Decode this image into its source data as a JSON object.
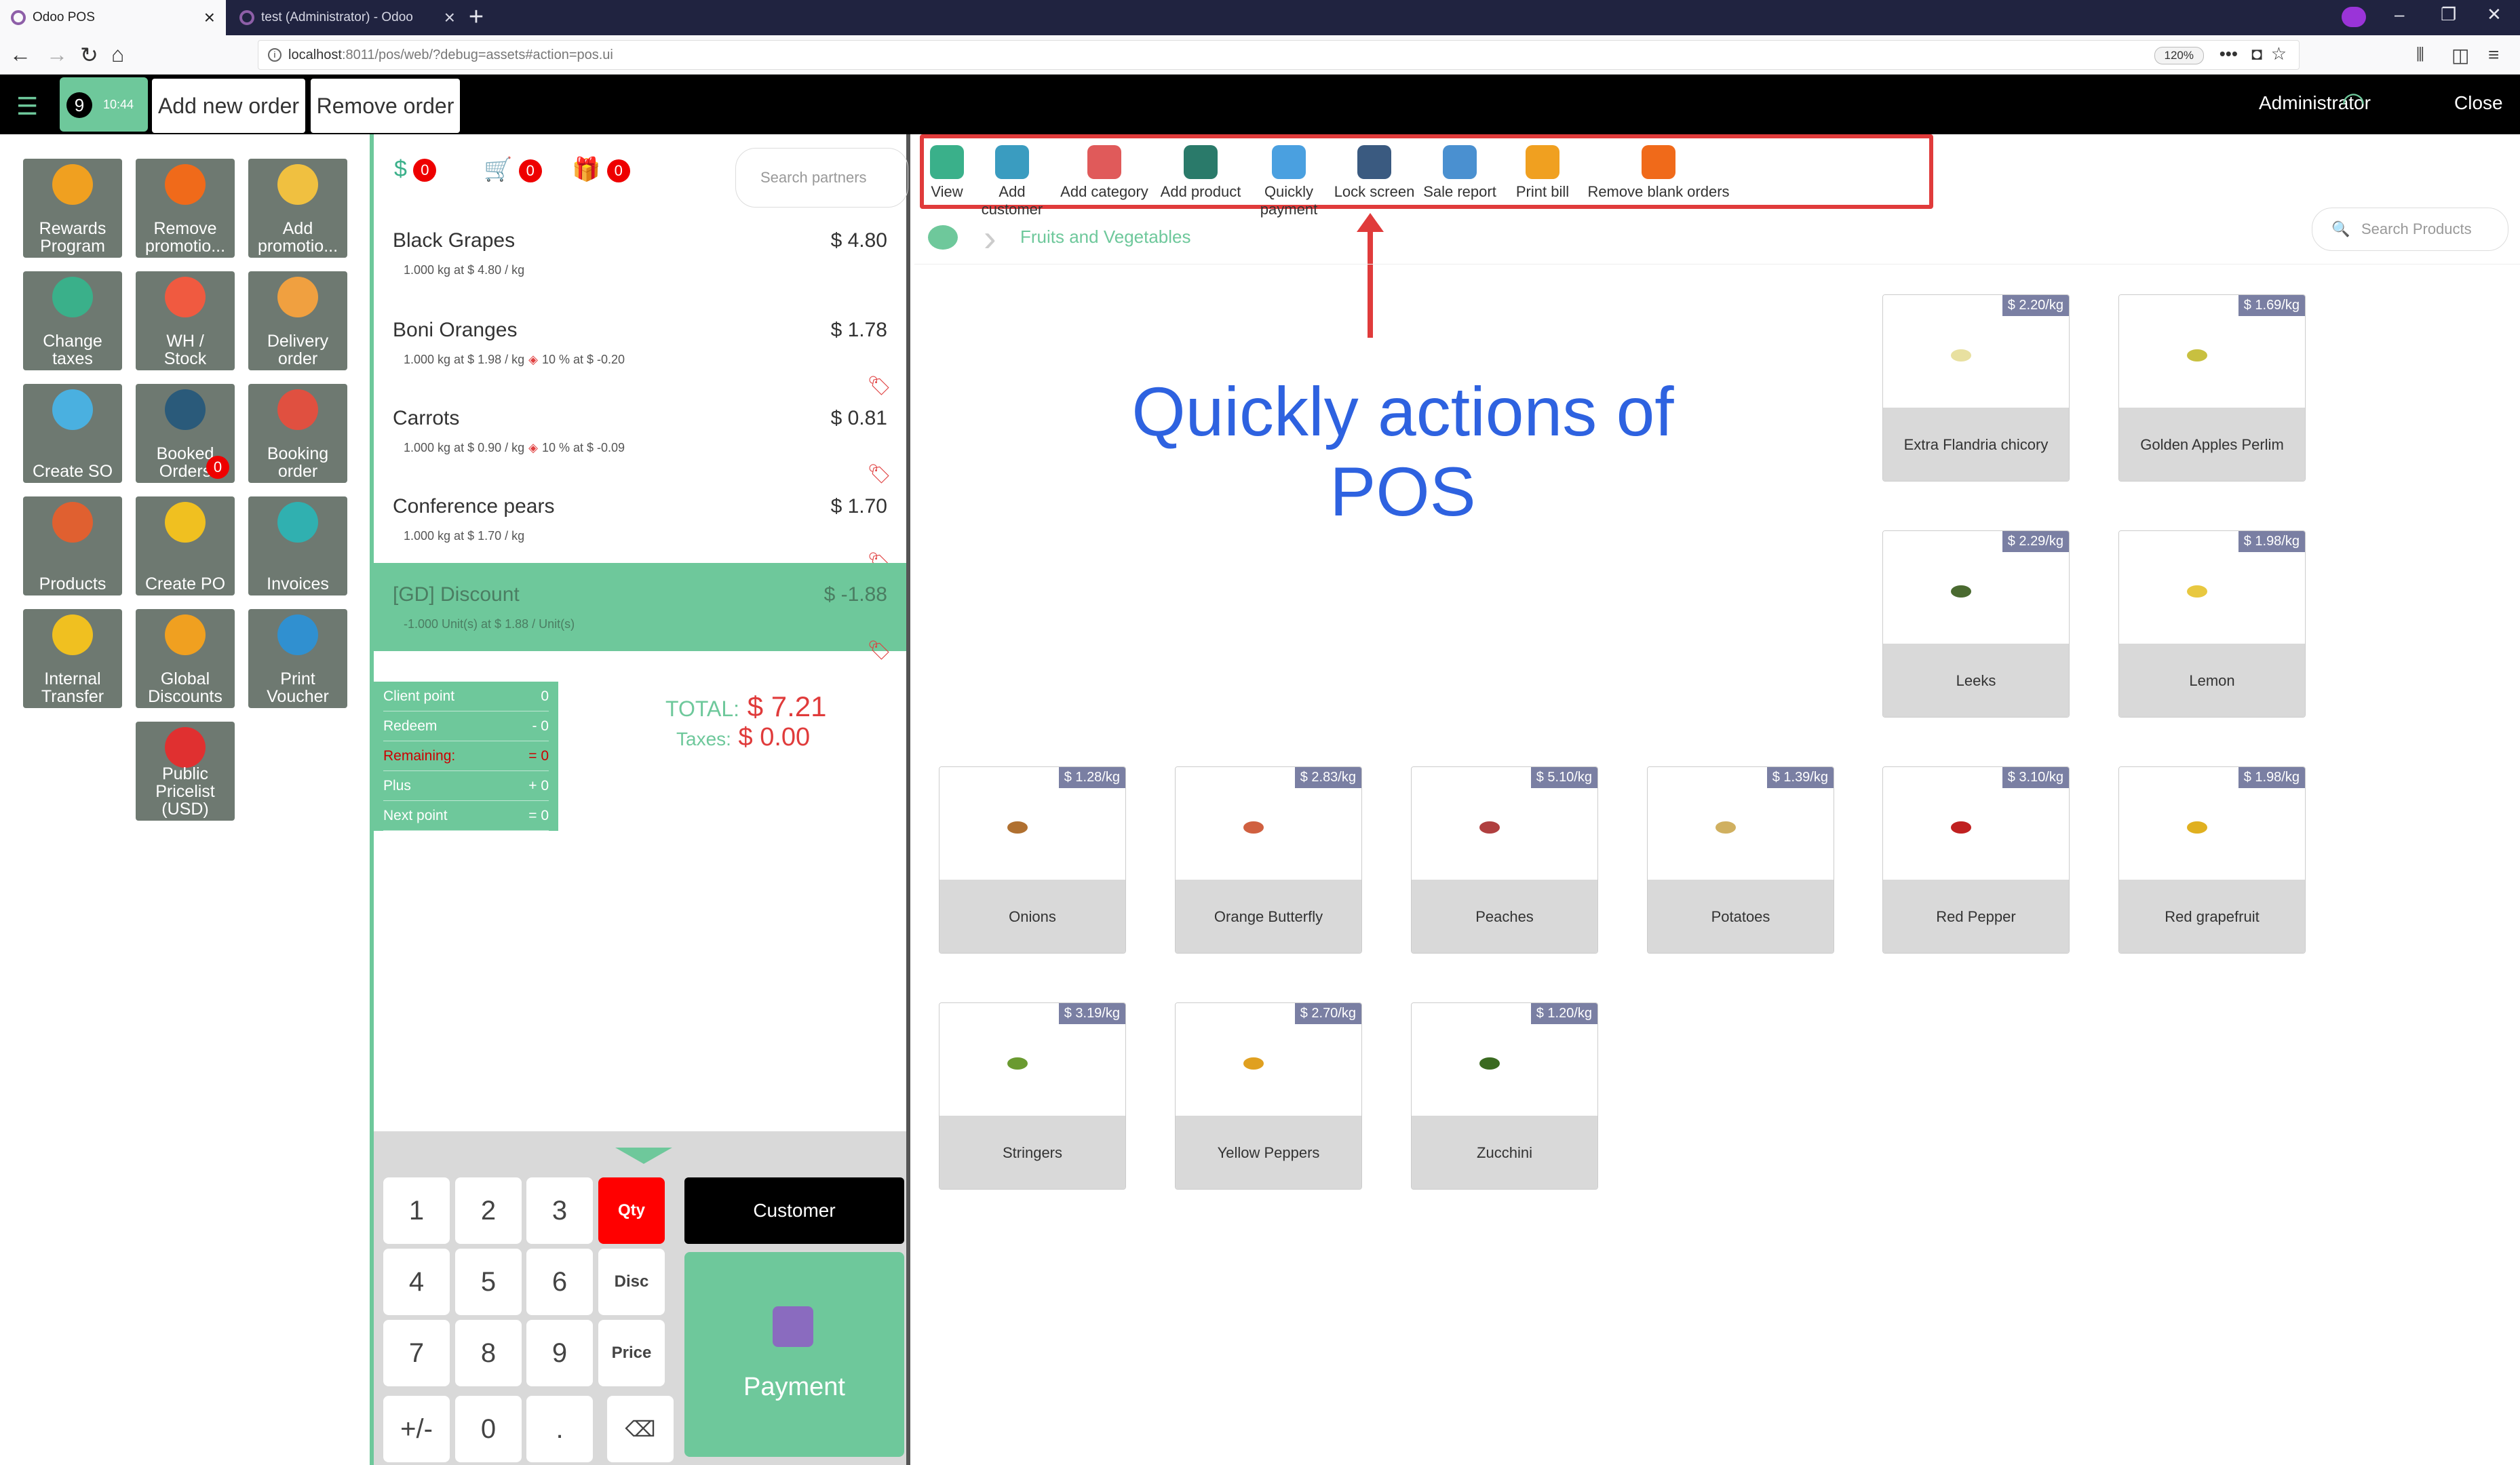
{
  "browser": {
    "tabs": [
      {
        "title": "Odoo POS"
      },
      {
        "title": "test (Administrator) - Odoo"
      }
    ],
    "url_host": "localhost",
    "url_rest": ":8011/pos/web/?debug=assets#action=pos.ui",
    "zoom": "120%",
    "dots": "•••"
  },
  "header": {
    "order_number": "9",
    "order_time": "10:44",
    "add_order_label": "Add new order",
    "remove_order_label": "Remove order",
    "user": "Administrator",
    "close_label": "Close"
  },
  "widgets": [
    {
      "label1": "Rewards",
      "label2": "Program",
      "icon": "rewards-icon",
      "color": "#f0a020"
    },
    {
      "label1": "Remove",
      "label2": "promotio...",
      "icon": "trash-icon",
      "color": "#f06a1a"
    },
    {
      "label1": "Add",
      "label2": "promotio...",
      "icon": "promotion-icon",
      "color": "#f0c040"
    },
    {
      "label1": "Change",
      "label2": "taxes",
      "icon": "taxes-icon",
      "color": "#3ab08a"
    },
    {
      "label1": "WH /",
      "label2": "Stock",
      "icon": "warehouse-icon",
      "color": "#f05a40"
    },
    {
      "label1": "Delivery",
      "label2": "order",
      "icon": "delivery-icon",
      "color": "#f0a040"
    },
    {
      "label1": "Create SO",
      "label2": "",
      "icon": "cart-icon",
      "color": "#4ab0e0"
    },
    {
      "label1": "Booked",
      "label2": "Orders",
      "icon": "booked-icon",
      "color": "#2a5a7a",
      "badge": "0"
    },
    {
      "label1": "Booking",
      "label2": "order",
      "icon": "headset-icon",
      "color": "#e05040"
    },
    {
      "label1": "Products",
      "label2": "",
      "icon": "barcode-icon",
      "color": "#e06030"
    },
    {
      "label1": "Create PO",
      "label2": "",
      "icon": "basket-icon",
      "color": "#f0c020"
    },
    {
      "label1": "Invoices",
      "label2": "",
      "icon": "invoice-icon",
      "color": "#30b0b0"
    },
    {
      "label1": "Internal",
      "label2": "Transfer",
      "icon": "truck-icon",
      "color": "#f0c020"
    },
    {
      "label1": "Global",
      "label2": "Discounts",
      "icon": "discount-tag-icon",
      "color": "#f0a020"
    },
    {
      "label1": "Print",
      "label2": "Voucher",
      "icon": "voucher-icon",
      "color": "#3090d0"
    },
    {
      "label1": "Public",
      "label2": "Pricelist",
      "label3": "(USD)",
      "icon": "pricelist-icon",
      "color": "#e03030"
    }
  ],
  "order": {
    "counters": [
      "0",
      "0",
      "0"
    ],
    "search_partners_placeholder": "Search partners",
    "lines": [
      {
        "name": "Black Grapes",
        "price": "$ 4.80",
        "info": "1.000 kg at $ 4.80 / kg",
        "discount": ""
      },
      {
        "name": "Boni Oranges",
        "price": "$ 1.78",
        "info": "1.000 kg at $ 1.98 / kg",
        "discount": "10 % at $ -0.20"
      },
      {
        "name": "Carrots",
        "price": "$ 0.81",
        "info": "1.000 kg at $ 0.90 / kg",
        "discount": "10 % at $ -0.09"
      },
      {
        "name": "Conference pears",
        "price": "$ 1.70",
        "info": "1.000 kg at $ 1.70 / kg",
        "discount": ""
      },
      {
        "name": "[GD] Discount",
        "price": "$ -1.88",
        "info": "-1.000 Unit(s) at $ 1.88 / Unit(s)",
        "discount": ""
      }
    ],
    "points": [
      {
        "label": "Client point",
        "value": "0"
      },
      {
        "label": "Redeem",
        "value": "- 0"
      },
      {
        "label": "Remaining:",
        "value": "= 0"
      },
      {
        "label": "Plus",
        "value": "+ 0"
      },
      {
        "label": "Next point",
        "value": "= 0"
      }
    ],
    "total_label": "TOTAL:",
    "total": "$ 7.21",
    "taxes_label": "Taxes:",
    "taxes": "$ 0.00"
  },
  "numpad": {
    "keys": [
      "1",
      "2",
      "3",
      "Qty",
      "4",
      "5",
      "6",
      "Disc",
      "7",
      "8",
      "9",
      "Price",
      "+/-",
      "0",
      "."
    ],
    "backspace": "⌫",
    "customer": "Customer",
    "payment": "Payment"
  },
  "quick_actions": [
    {
      "label": "View",
      "icon": "view-list-icon",
      "color": "#3ab08a"
    },
    {
      "label": "Add customer",
      "icon": "add-customer-icon",
      "color": "#3a9cc0"
    },
    {
      "label": "Add category",
      "icon": "category-tree-icon",
      "color": "#e05a5a"
    },
    {
      "label": "Add product",
      "icon": "add-product-icon",
      "color": "#2a7a6a"
    },
    {
      "label": "Quickly payment",
      "icon": "quick-payment-icon",
      "color": "#4aa0e0"
    },
    {
      "label": "Lock screen",
      "icon": "lock-screen-icon",
      "color": "#3a5a80"
    },
    {
      "label": "Sale report",
      "icon": "sale-report-icon",
      "color": "#4a90d0"
    },
    {
      "label": "Print bill",
      "icon": "printer-icon",
      "color": "#f0a020"
    },
    {
      "label": "Remove blank orders",
      "icon": "trash-icon",
      "color": "#f06a1a"
    }
  ],
  "annotation": "Quickly actions of POS",
  "category": "Fruits and Vegetables",
  "search_products_placeholder": "Search Products",
  "products": [
    {
      "name": "Extra Flandria chicory",
      "price": "$ 2.20/kg",
      "color": "#e8e0a0"
    },
    {
      "name": "Golden Apples Perlim",
      "price": "$ 1.69/kg",
      "color": "#c8c040"
    },
    {
      "name": "Leeks",
      "price": "$ 2.29/kg",
      "color": "#4a6a30"
    },
    {
      "name": "Lemon",
      "price": "$ 1.98/kg",
      "color": "#e8c840"
    },
    {
      "name": "Onions",
      "price": "$ 1.28/kg",
      "color": "#b07030"
    },
    {
      "name": "Orange Butterfly",
      "price": "$ 2.83/kg",
      "color": "#d06040"
    },
    {
      "name": "Peaches",
      "price": "$ 5.10/kg",
      "color": "#b04040"
    },
    {
      "name": "Potatoes",
      "price": "$ 1.39/kg",
      "color": "#d0b060"
    },
    {
      "name": "Red Pepper",
      "price": "$ 3.10/kg",
      "color": "#c02020"
    },
    {
      "name": "Red grapefruit",
      "price": "$ 1.98/kg",
      "color": "#e0b020"
    },
    {
      "name": "Stringers",
      "price": "$ 3.19/kg",
      "color": "#6a9a30"
    },
    {
      "name": "Yellow Peppers",
      "price": "$ 2.70/kg",
      "color": "#e0a020"
    },
    {
      "name": "Zucchini",
      "price": "$ 1.20/kg",
      "color": "#3a6a20"
    }
  ]
}
